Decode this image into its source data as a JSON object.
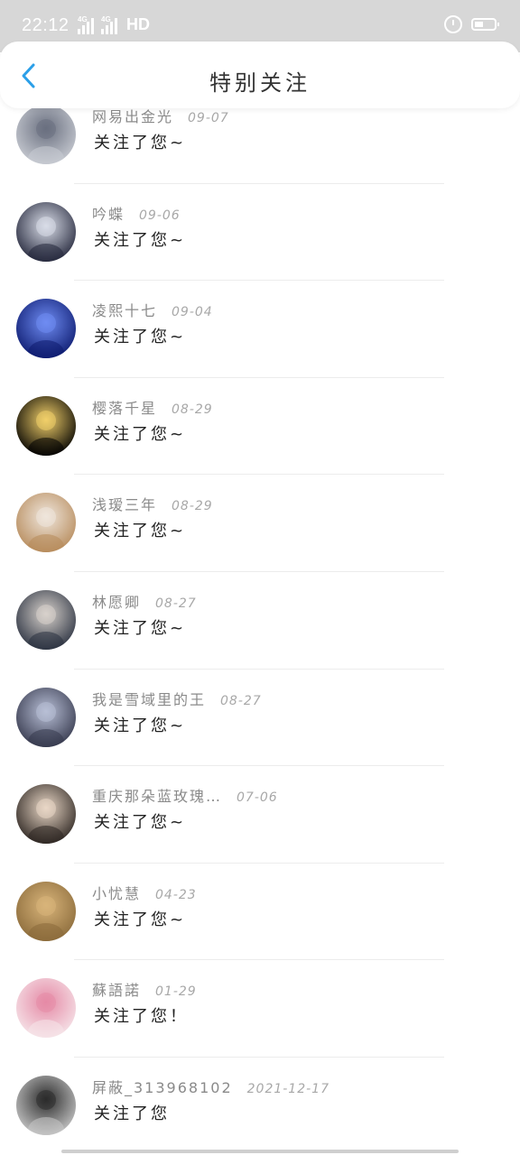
{
  "status_bar": {
    "time": "22:12",
    "network_label": "4G",
    "hd_label": "HD",
    "icons": [
      "signal-icon",
      "signal-icon",
      "alarm-icon",
      "battery-icon"
    ]
  },
  "header": {
    "title": "特别关注",
    "back_icon": "chevron-left-icon",
    "accent_color": "#2b9fe8"
  },
  "notifications": [
    {
      "name": "网易出金光",
      "date": "09-07",
      "message": "关注了您~",
      "avatar_colors": [
        "#c9ccd3",
        "#6a7080"
      ]
    },
    {
      "name": "吟蝶",
      "date": "09-06",
      "message": "关注了您~",
      "avatar_colors": [
        "#23263a",
        "#d9dde8"
      ]
    },
    {
      "name": "凌熙十七",
      "date": "09-04",
      "message": "关注了您~",
      "avatar_colors": [
        "#0c1a6e",
        "#6f8cf2"
      ]
    },
    {
      "name": "樱落千星",
      "date": "08-29",
      "message": "关注了您~",
      "avatar_colors": [
        "#000000",
        "#f1cf6a"
      ]
    },
    {
      "name": "浅瑷三年",
      "date": "08-29",
      "message": "关注了您~",
      "avatar_colors": [
        "#b68a5a",
        "#efe6dc"
      ]
    },
    {
      "name": "林愿卿",
      "date": "08-27",
      "message": "关注了您~",
      "avatar_colors": [
        "#2a3140",
        "#d8d2cc"
      ]
    },
    {
      "name": "我是雪域里的王",
      "date": "08-27",
      "message": "关注了您~",
      "avatar_colors": [
        "#35384c",
        "#b8bfd6"
      ]
    },
    {
      "name": "重庆那朵蓝玫瑰…",
      "date": "07-06",
      "message": "关注了您~",
      "avatar_colors": [
        "#2b2420",
        "#e9d7c6"
      ]
    },
    {
      "name": "小忧慧",
      "date": "04-23",
      "message": "关注了您~",
      "avatar_colors": [
        "#8a6a3a",
        "#d8b47a"
      ]
    },
    {
      "name": "蘇語諾",
      "date": "01-29",
      "message": "关注了您！",
      "avatar_colors": [
        "#f6e6ea",
        "#e58aa6"
      ]
    },
    {
      "name": "屏蔽_313968102",
      "date": "2021-12-17",
      "message": "关注了您",
      "avatar_colors": [
        "#c9c9c9",
        "#2b2b2b"
      ]
    }
  ]
}
